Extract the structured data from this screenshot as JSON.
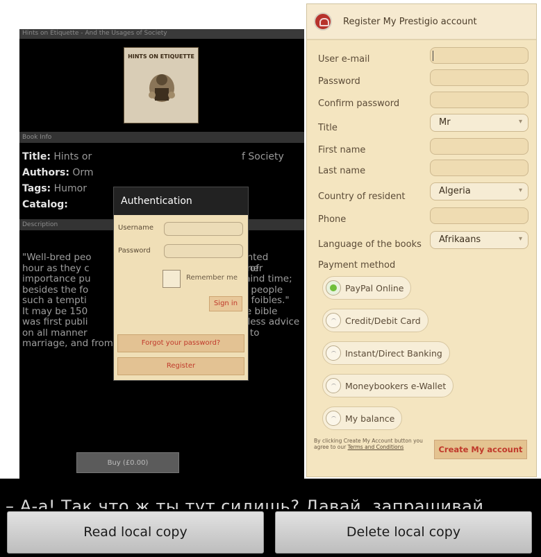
{
  "book": {
    "header_title": "Hints on Etiquette - And the Usages of Society",
    "cover_title": "HINTS ON ETIQUETTE",
    "section_info": "Book Info",
    "section_desc": "Description",
    "rows": [
      {
        "key": "Title:",
        "value": "Hints or",
        "value2": "f Society"
      },
      {
        "key": "Authors:",
        "value": "Orm"
      },
      {
        "key": "Tags:",
        "value": "Humor"
      },
      {
        "key": "Catalog:",
        "value": ""
      }
    ],
    "description_lines": [
      [
        "\"Well-bred peo",
        "pointed dinner"
      ],
      [
        "hour as they c",
        "ion of"
      ],
      [
        "importance pu",
        "behind time;"
      ],
      [
        "besides the fo",
        "gry people"
      ],
      [
        "such a tempti",
        "our foibles.\""
      ],
      [
        "It may be 150",
        "ette bible"
      ],
      [
        "was first publi",
        "meless advice"
      ],
      [
        "on all manner",
        "ble to"
      ],
      [
        "marriage, and from smoking to fashion.",
        ""
      ]
    ],
    "buy_label": "Buy (£0.00)"
  },
  "auth": {
    "title": "Authentication",
    "username_label": "Username",
    "password_label": "Password",
    "remember_label": "Remember me",
    "signin_label": "Sign in",
    "forgot_label": "Forgot your password?",
    "register_label": "Register"
  },
  "register": {
    "title": "Register My Prestigio account",
    "fields": {
      "email": "User e-mail",
      "password": "Password",
      "confirm": "Confirm password",
      "title": "Title",
      "first_name": "First name",
      "last_name": "Last name",
      "country": "Country of resident",
      "phone": "Phone",
      "language": "Language of the books"
    },
    "title_value": "Mr",
    "country_value": "Algeria",
    "language_value": "Afrikaans",
    "payment_label": "Payment method",
    "payment_options": [
      {
        "label": "PayPal Online",
        "selected": true
      },
      {
        "label": "Credit/Debit Card",
        "selected": false
      },
      {
        "label": "Instant/Direct Banking",
        "selected": false
      },
      {
        "label": "Moneybookers e-Wallet",
        "selected": false
      },
      {
        "label": "My balance",
        "selected": false
      }
    ],
    "terms_text": "By clicking Create My Account button you agree to our",
    "terms_link": "Terms and Conditions",
    "create_label": "Create My account"
  },
  "reader": {
    "text_line": "– А-а! Так что ж ты тут сидишь? Давай, запрашивай",
    "read_label": "Read local copy",
    "delete_label": "Delete local copy"
  },
  "colors": {
    "accent_red": "#c0392b",
    "radio_selected": "#6fbf3a",
    "panel_beige": "#f4e5c0"
  },
  "icons": [
    "prestigio-logo-icon",
    "radio-selected-icon",
    "radio-unselected-icon",
    "dropdown-arrow-icon",
    "book-cover-image"
  ]
}
